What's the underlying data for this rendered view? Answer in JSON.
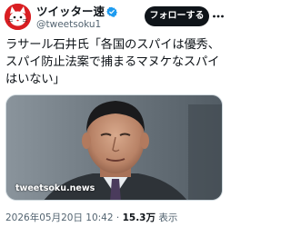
{
  "tweet": {
    "display_name": "ツイッター速報...",
    "handle": "@tweetsoku1",
    "follow_label": "フォローする",
    "text_lines": [
      "ラサール石井氏「各国のスパイは優秀、",
      "スパイ防止法案で捕まるマヌケなスパイ",
      "はいない」"
    ],
    "media": {
      "watermark": "tweetsoku.news"
    },
    "timestamp": "2026年05月20日 10:42",
    "separator": "·",
    "views_count": "15.3万",
    "views_label": "表示"
  },
  "colors": {
    "avatar": "#d91e22",
    "verified": "#1d9bf0",
    "follow_button": "#0f1419",
    "secondary_text": "#536471"
  },
  "icons": {
    "avatar": "cat-avatar-icon",
    "verified": "verified-badge-icon",
    "more": "more-options-icon"
  }
}
